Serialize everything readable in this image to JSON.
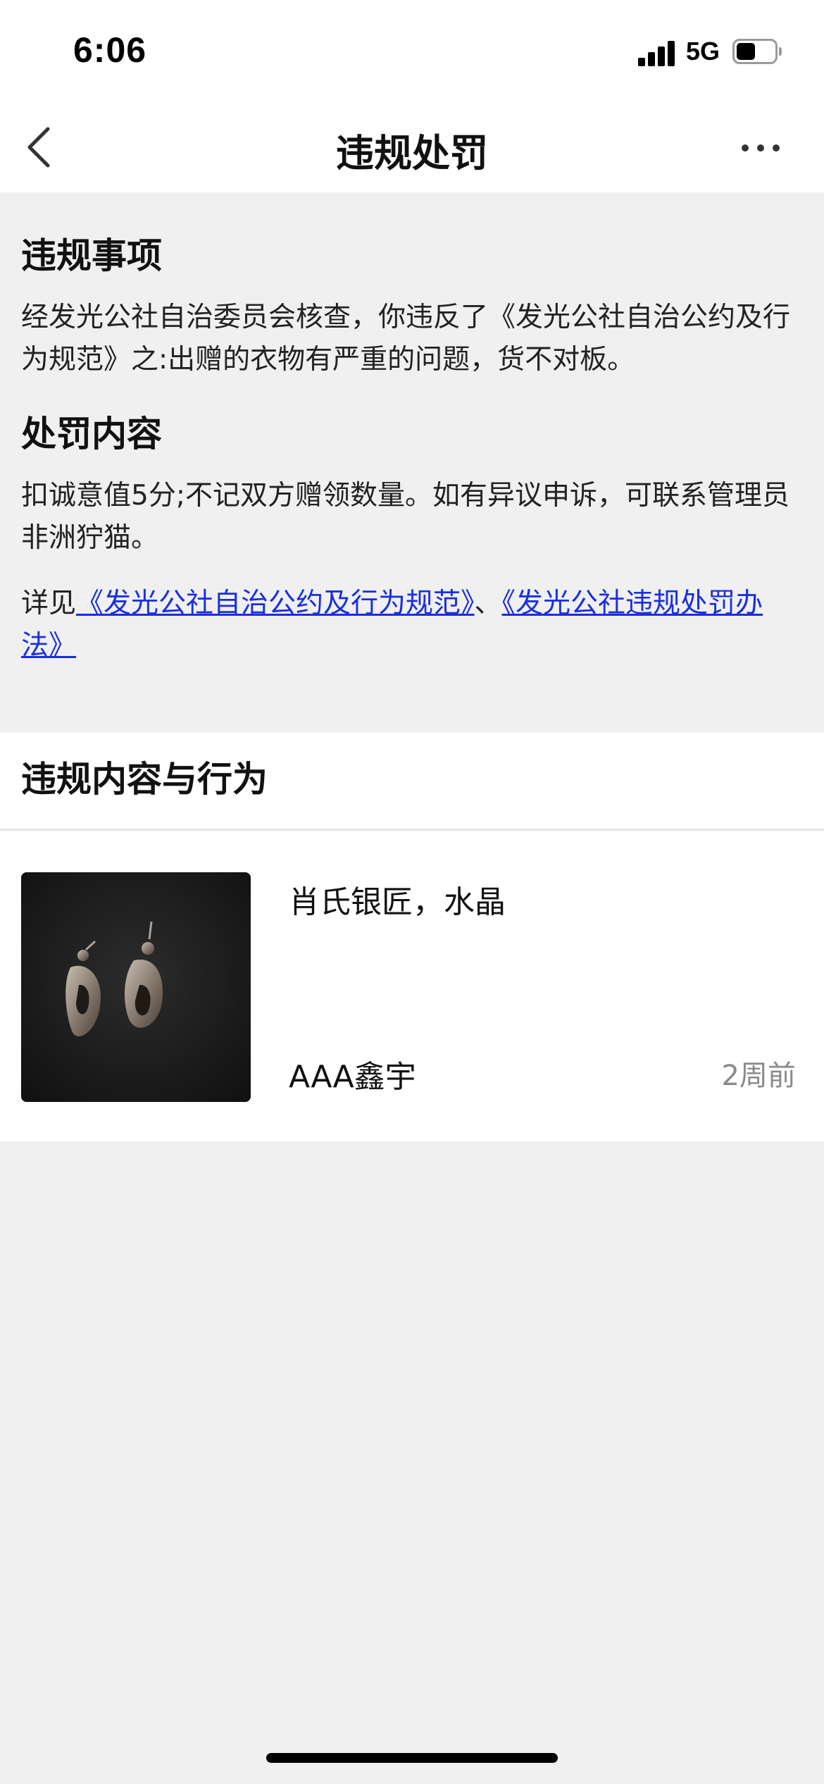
{
  "status_bar": {
    "time": "6:06",
    "network": "5G",
    "battery_level": 0.5
  },
  "nav": {
    "title": "违规处罚",
    "back_icon": "chevron-left-icon",
    "more_icon": "more-horizontal-icon"
  },
  "violation": {
    "heading": "违规事项",
    "text": "经发光公社自治委员会核查，你违反了《发光公社自治公约及行为规范》之:出赠的衣物有严重的问题，货不对板。",
    "penalty_heading": "处罚内容",
    "penalty_text": "扣诚意值5分;不记双方赠领数量。如有异议申诉，可联系管理员非洲狞猫。",
    "see_prefix": "详见",
    "link1": "《发光公社自治公约及行为规范》",
    "separator": "、",
    "link2": "《发光公社违规处罚办法》",
    "link_color": "#1a2fe0"
  },
  "content": {
    "heading": "违规内容与行为",
    "item": {
      "title": "肖氏银匠，水晶",
      "user": "AAA鑫宇",
      "time": "2周前",
      "image": "earrings-photo"
    }
  }
}
